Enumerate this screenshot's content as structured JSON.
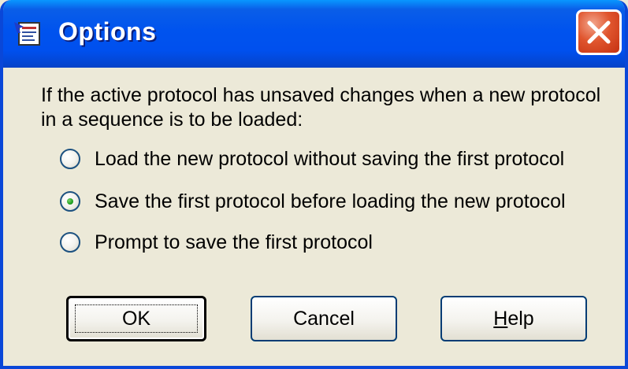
{
  "window": {
    "title": "Options",
    "accent_color": "#0053EE",
    "close_color": "#E0552E"
  },
  "dialog": {
    "prompt": "If the active protocol has unsaved changes when a new protocol in a sequence is to be loaded:",
    "options": [
      {
        "label": "Load the new protocol without saving the first protocol",
        "checked": false
      },
      {
        "label": "Save the first protocol before loading the new protocol",
        "checked": true
      },
      {
        "label": "Prompt to save the first protocol",
        "checked": false
      }
    ]
  },
  "buttons": {
    "ok_label": "OK",
    "cancel_label": "Cancel",
    "help_mnemonic": "H",
    "help_rest": "elp"
  },
  "icons": {
    "app": "options-dialog-app-icon",
    "close": "close-icon"
  }
}
